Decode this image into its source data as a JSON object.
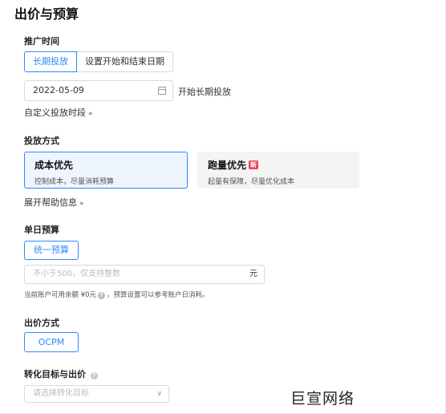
{
  "page": {
    "title": "出价与预算"
  },
  "promo_time": {
    "label": "推广时间",
    "tabs": [
      "长期投放",
      "设置开始和结束日期"
    ],
    "date_value": "2022-05-09",
    "date_suffix": "开始长期投放",
    "custom_toggle": "自定义投放时段",
    "chevron": "»"
  },
  "delivery": {
    "label": "投放方式",
    "cards": [
      {
        "title": "成本优先",
        "desc": "控制成本，尽量消耗预算"
      },
      {
        "title": "跑量优先",
        "badge": "新",
        "desc": "起量有保障，尽量优化成本"
      }
    ],
    "expand_help": "展开帮助信息"
  },
  "budget": {
    "label": "单日预算",
    "button": "统一预算",
    "placeholder": "不小于500，仅支持整数",
    "unit": "元",
    "hint_pre": "当前账户可用余额 ¥0元",
    "hint_post": "，预算设置可以参考账户日消耗。",
    "help_glyph": "?"
  },
  "bid": {
    "label": "出价方式",
    "button": "OCPM"
  },
  "conversion": {
    "label": "转化目标与出价",
    "help_glyph": "?",
    "placeholder": "请选择转化目标",
    "arrow": "∨"
  },
  "watermark": "巨宣网络",
  "colors": {
    "accent": "#2f88ff",
    "badge": "#f0425a",
    "card_selected_bg": "#eef5ff"
  }
}
